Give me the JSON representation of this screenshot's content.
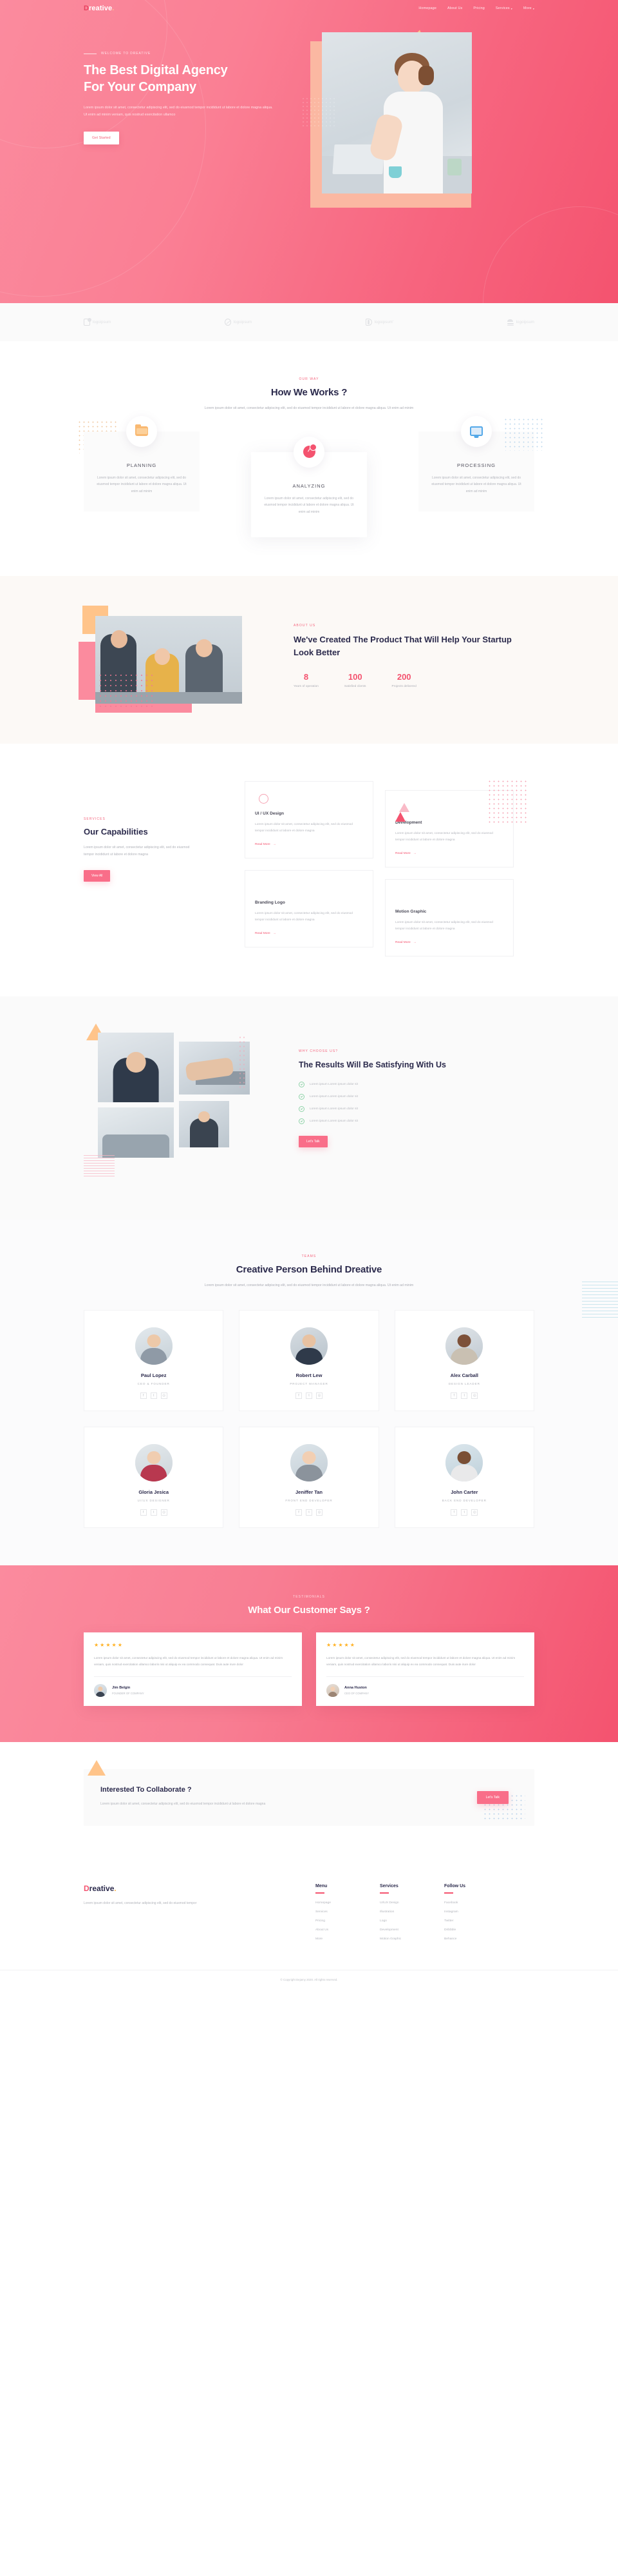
{
  "brand": {
    "first_letter": "D",
    "rest": "reative",
    "dot": "."
  },
  "nav": {
    "items": [
      {
        "label": "Homepage",
        "caret": ""
      },
      {
        "label": "About Us",
        "caret": ""
      },
      {
        "label": "Pricing",
        "caret": ""
      },
      {
        "label": "Services",
        "caret": "▾"
      },
      {
        "label": "More",
        "caret": "▾"
      }
    ]
  },
  "hero": {
    "eyebrow": "WELCOME TO DREATIVE",
    "title_line1": "The Best Digital Agency",
    "title_line2": "For Your Company",
    "paragraph": "Lorem ipsum dolor sit amet, consectetur adipiscing elit, sed do eiusmod tempor incididunt ut labore et dolore magna aliqua. Ut enim ad minim veniam, quis nostrud exercitation ullamco",
    "cta": "Get Started"
  },
  "clients": {
    "logos": [
      {
        "name": "logoipsum"
      },
      {
        "name": "logoipsum"
      },
      {
        "name": "logoipsum'"
      },
      {
        "name": "logoipsum"
      }
    ]
  },
  "how": {
    "kicker": "OUR WAY",
    "title": "How We Works ?",
    "subtitle": "Lorem ipsum dolor sit amet, consectetur adipiscing elit, sed do eiusmod tempor incididunt ut labore et dolore magna aliqua. Ut enim ad minim",
    "cards": [
      {
        "icon": "folder-icon",
        "title": "PLANNING",
        "text": "Lorem ipsum dolor sit amet, consectetur adipiscing elit, sed do eiusmod tempor incididunt ut labore et dolore magna aliqua. Ut enim ad minim"
      },
      {
        "icon": "pie-chart-icon",
        "title": "ANALYZING",
        "text": "Lorem ipsum dolor sit amet, consectetur adipiscing elit, sed do eiusmod tempor incididunt ut labore et dolore magna aliqua. Ut enim ad minim"
      },
      {
        "icon": "monitor-icon",
        "title": "PROCESSING",
        "text": "Lorem ipsum dolor sit amet, consectetur adipiscing elit, sed do eiusmod tempor incididunt ut labore et dolore magna aliqua. Ut enim ad minim"
      }
    ]
  },
  "about": {
    "kicker": "ABOUT US",
    "title": "We've Created The Product That Will Help Your Startup Look Better",
    "stats": [
      {
        "value": "8",
        "label": "Years of operation"
      },
      {
        "value": "100",
        "label": "Satisfied clients"
      },
      {
        "value": "200",
        "label": "Projects delivered"
      }
    ]
  },
  "capabilities": {
    "kicker": "SERVICES",
    "title": "Our Capabilities",
    "text": "Lorem ipsum dolor sit amet, consectetur adipiscing elit, sed do eiusmod tempor incididunt ut labore et dolore magna",
    "cta": "View All",
    "cards": [
      {
        "icon": "circles-icon",
        "title": "UI / UX Design",
        "text": "Lorem ipsum dolor sit amet, consectetur adipiscing elit, sed do eiusmod tempor incididunt ut labore et dolore magna",
        "link": "Read More"
      },
      {
        "icon": "triangle-icon",
        "title": "Development",
        "text": "Lorem ipsum dolor sit amet, consectetur adipiscing elit, sed do eiusmod tempor incididunt ut labore et dolore magna",
        "link": "Read More"
      },
      {
        "icon": "pentagon-icon",
        "title": "Branding Logo",
        "text": "Lorem ipsum dolor sit amet, consectetur adipiscing elit, sed do eiusmod tempor incididunt ut labore et dolore magna",
        "link": "Read More"
      },
      {
        "icon": "half-circle-icon",
        "title": "Motion Graphic",
        "text": "Lorem ipsum dolor sit amet, consectetur adipiscing elit, sed do eiusmod tempor incididunt ut labore et dolore magna",
        "link": "Read More"
      }
    ]
  },
  "why": {
    "kicker": "WHY CHOOSE US?",
    "title": "The Results Will Be Satisfying With Us",
    "checklist": [
      "Lorem ipsum Lorem ipsum dolor sit",
      "Lorem ipsum Lorem ipsum dolor sit",
      "Lorem ipsum Lorem ipsum dolor sit",
      "Lorem ipsum Lorem ipsum dolor sit"
    ],
    "cta": "Let's Talk"
  },
  "teams": {
    "kicker": "TEAMS",
    "title": "Creative Person Behind Dreative",
    "subtitle": "Lorem ipsum dolor sit amet, consectetur adipiscing elit, sed do eiusmod tempor incididunt ut labore et dolore magna aliqua. Ut enim ad minim",
    "members": [
      {
        "name": "Paul Lopez",
        "role": "CEO & FOUNDER"
      },
      {
        "name": "Robert Lew",
        "role": "PROJECT MANAGER"
      },
      {
        "name": "Alex Carball",
        "role": "DESIGN LEADER"
      },
      {
        "name": "Gloria Jesica",
        "role": "UI/UX DESIGNER"
      },
      {
        "name": "Jeniffer Tan",
        "role": "FRONT END DEVELOPER"
      },
      {
        "name": "John Carter",
        "role": "BACK END DEVELOPER"
      }
    ],
    "social_icons": [
      "facebook-icon",
      "twitter-icon",
      "instagram-icon"
    ]
  },
  "testimonials": {
    "kicker": "TESTIMONIALS",
    "title": "What Our Customer Says ?",
    "items": [
      {
        "rating": 5,
        "quote": "Lorem ipsum dolor sit amet, consectetur adipiscing elit, sed do eiusmod tempor incididunt ut labore et dolore magna aliqua. Ut enim ad minim veniam, quis nostrud exercitation ullamco laboris nisi ut aliquip ex ea commodo consequat. Duis aute irure dolor",
        "name": "Jim Belgin",
        "role": "FOUNDER OF COMPANY"
      },
      {
        "rating": 5,
        "quote": "Lorem ipsum dolor sit amet, consectetur adipiscing elit, sed do eiusmod tempor incididunt ut labore et dolore magna aliqua. Ut enim ad minim veniam, quis nostrud exercitation ullamco laboris nisi ut aliquip ex ea commodo consequat. Duis aute irure dolor",
        "name": "Anna Huston",
        "role": "CEO OF COMPANY"
      }
    ]
  },
  "cta_section": {
    "title": "Interested To Collaborate ?",
    "text": "Lorem ipsum dolor sit amet, consectetur adipiscing elit, sed do eiusmod tempor incididunt ut labore et dolore magna",
    "button": "Let's Talk"
  },
  "footer": {
    "description": "Lorem ipsum dolor sit amet, consectetur adipiscing elit, sed do eiusmod tempor",
    "columns": [
      {
        "title": "Menu",
        "links": [
          "Homepage",
          "Services",
          "Pricing",
          "About Us",
          "More"
        ]
      },
      {
        "title": "Services",
        "links": [
          "UI/UX Design",
          "Illustration",
          "Logo",
          "Development",
          "Motion Graphic"
        ]
      },
      {
        "title": "Follow Us",
        "links": [
          "Facebook",
          "Instagram",
          "Twitter",
          "Dribbble",
          "Behance"
        ]
      }
    ],
    "copyright": "© Copyright Dejamy 2020. All rights reserved."
  },
  "colors": {
    "pink": "#f4536f",
    "pink_light": "#fb8b9e",
    "navy": "#2b2a4c",
    "orange": "#ffc48a",
    "star": "#ffb020"
  }
}
